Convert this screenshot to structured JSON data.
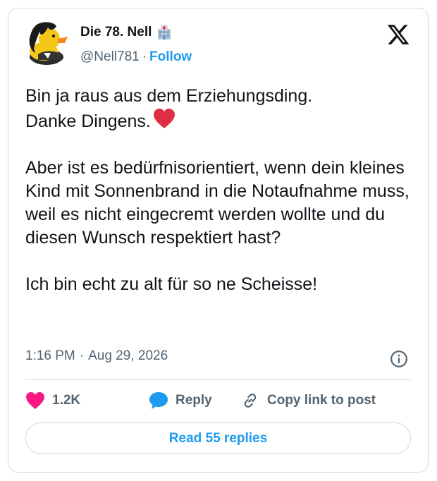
{
  "author": {
    "name": "Die 78. Nell",
    "handle": "@Nell781",
    "separator": "·",
    "follow_label": "Follow",
    "badge_icon": "hospital-icon",
    "avatar_icon": "rubber-duck-avatar"
  },
  "tweet": {
    "paragraph1_line1": "Bin ja raus aus dem Erziehungsding.",
    "paragraph1_line2": "Danke Dingens.",
    "paragraph2": "Aber ist es bedürfnisorientiert, wenn dein kleines Kind mit Sonnenbrand in die Notaufnahme muss, weil es nicht eingecremt werden wollte und du diesen Wunsch respektiert hast?",
    "paragraph3": "Ich bin echt zu alt für so ne Scheisse!",
    "time": "1:16 PM",
    "date": "Aug 29, 2026",
    "separator": "·"
  },
  "actions": {
    "like_count": "1.2K",
    "reply_label": "Reply",
    "copy_link_label": "Copy link to post"
  },
  "read_replies_label": "Read 55 replies",
  "colors": {
    "accent": "#1d9bf0",
    "heart": "#f91880",
    "text": "#0f1419",
    "muted": "#536471",
    "border": "#cfd9de"
  }
}
